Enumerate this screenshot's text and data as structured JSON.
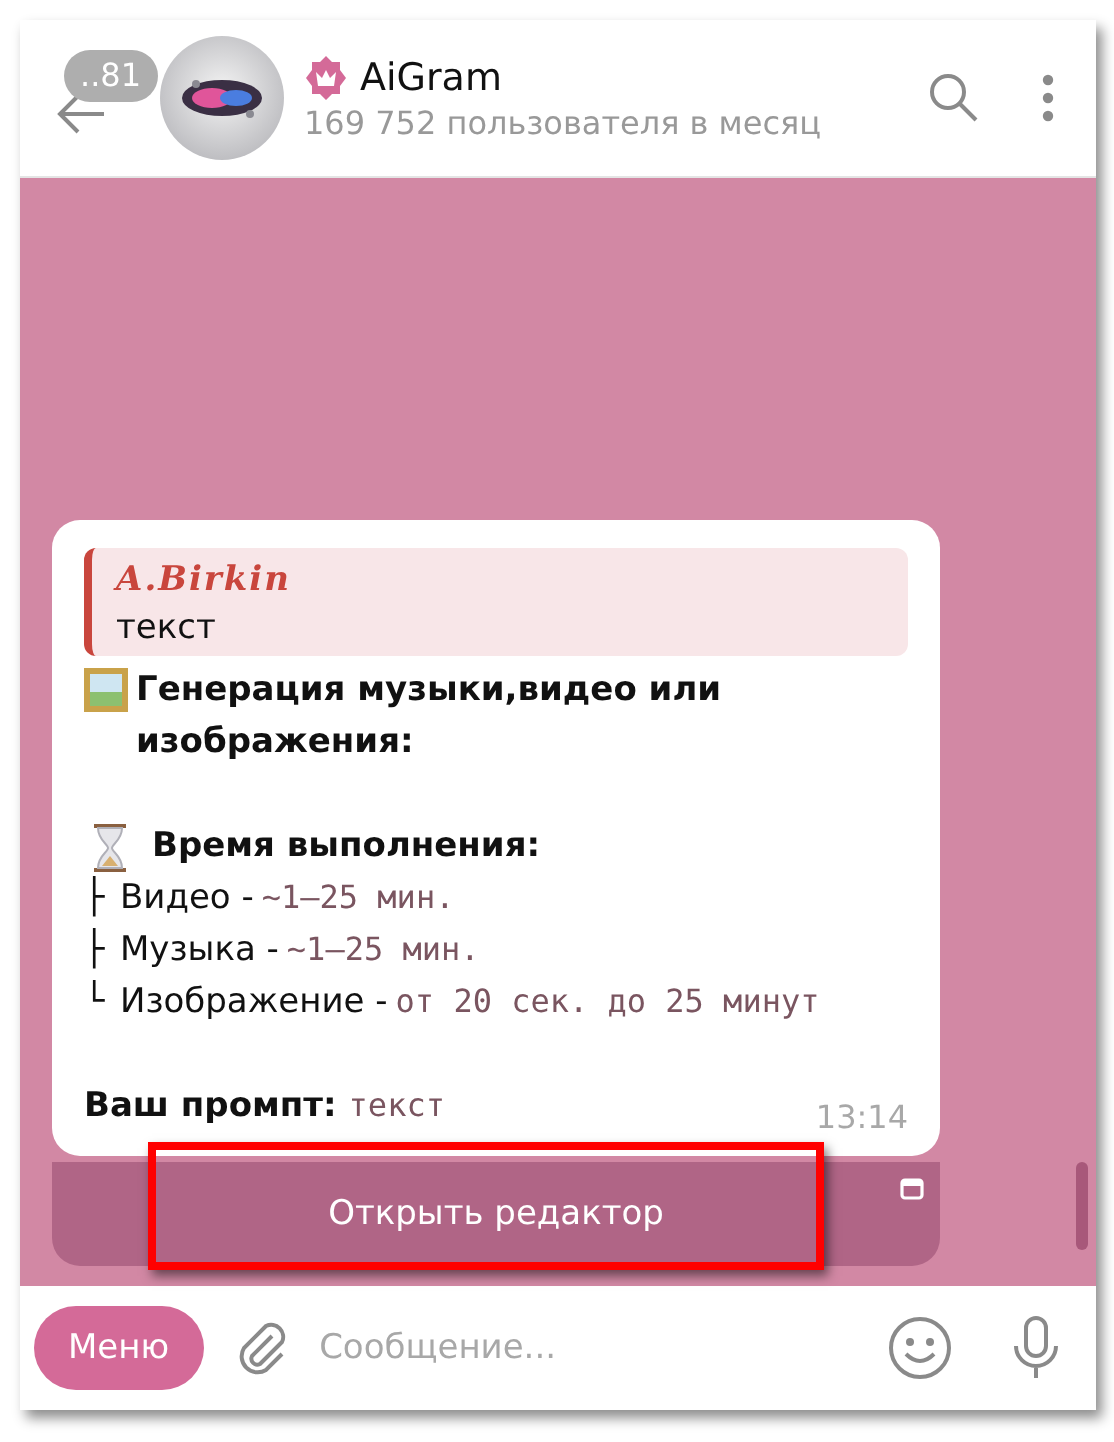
{
  "header": {
    "back_badge": "..81",
    "title": "AiGram",
    "subtitle": "169 752 пользователя в месяц"
  },
  "message": {
    "quote": {
      "author": "A.Birkin",
      "text": "текст"
    },
    "heading": "Генерация музыки,видео или изображения:",
    "time_heading": "Время выполнения:",
    "items": [
      {
        "prefix": "├",
        "label": "Видео -",
        "value": "~1–25 мин."
      },
      {
        "prefix": "├",
        "label": "Музыка -",
        "value": "~1–25 мин."
      },
      {
        "prefix": "└",
        "label": "Изображение -",
        "value": "от 20 сек. до 25 минут"
      }
    ],
    "prompt": {
      "label": "Ваш промпт:",
      "value": "текст"
    },
    "time": "13:14"
  },
  "keyboard_button": {
    "label": "Открыть редактор",
    "highlighted": true
  },
  "input": {
    "menu_button": "Меню",
    "placeholder": "Сообщение..."
  }
}
